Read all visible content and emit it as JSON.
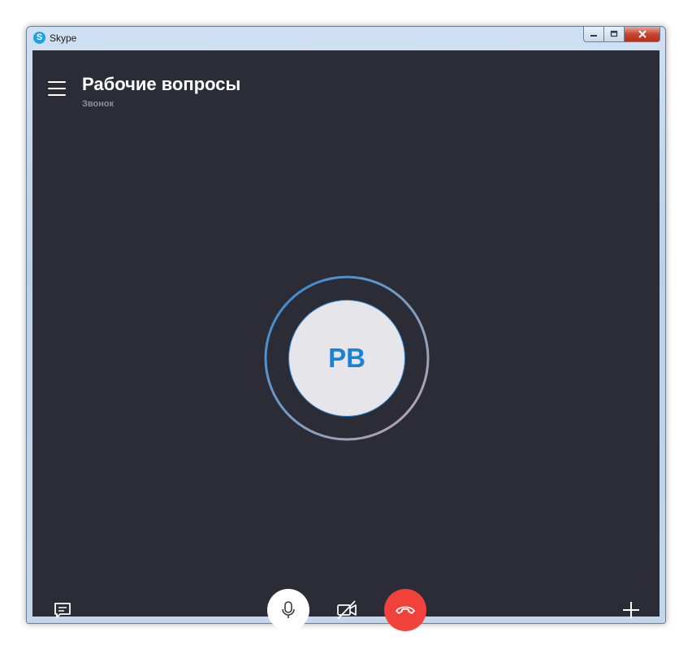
{
  "window": {
    "app_title": "Skype",
    "app_icon_letter": "S",
    "controls": {
      "minimize": "",
      "maximize": "",
      "close": ""
    }
  },
  "conversation": {
    "title": "Рабочие вопросы",
    "subtitle": "Звонок"
  },
  "call": {
    "avatar_initials": "PB"
  },
  "controls": {
    "chat_icon": "chat-icon",
    "mic_icon": "microphone-icon",
    "video_icon": "video-off-icon",
    "end_call_icon": "hang-up-icon",
    "add_icon": "plus-icon"
  },
  "colors": {
    "background": "#2b2c35",
    "accent": "#1e82d2",
    "end_call": "#f0423a",
    "avatar_bg": "#e6e5ea"
  }
}
